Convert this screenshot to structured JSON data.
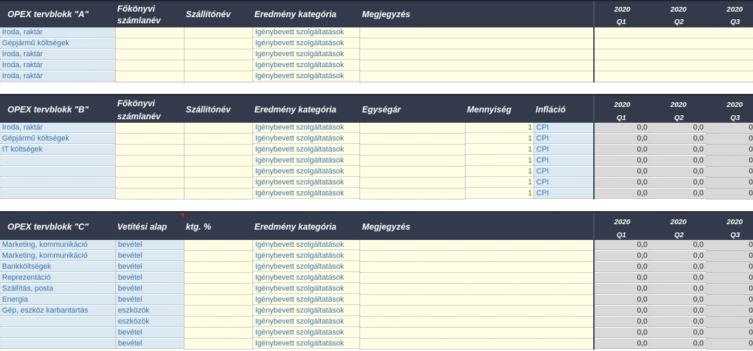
{
  "block_a": {
    "title": "OPEX tervblokk \"A\"",
    "col_fokonyvi": "Főkönyvi",
    "col_fokonyvi2": "számlanév",
    "col_szallito": "Szállítónév",
    "col_eredmeny": "Eredmény kategória",
    "col_megjegyzes": "Megjegyzés",
    "quarters": [
      {
        "year": "2020",
        "q": "Q1"
      },
      {
        "year": "2020",
        "q": "Q2"
      },
      {
        "year": "2020",
        "q": "Q3"
      }
    ],
    "rows": [
      {
        "name": "Iroda, raktár",
        "cat": "Igénybevett szolgáltatások"
      },
      {
        "name": "Gépjármű költségek",
        "cat": "Igénybevett szolgáltatások"
      },
      {
        "name": "Iroda, raktár",
        "cat": "Igénybevett szolgáltatások"
      },
      {
        "name": "Iroda, raktár",
        "cat": "Igénybevett szolgáltatások"
      },
      {
        "name": "Iroda, raktár",
        "cat": "Igénybevett szolgáltatások"
      }
    ]
  },
  "block_b": {
    "title": "OPEX tervblokk \"B\"",
    "col_fokonyvi": "Főkönyvi",
    "col_fokonyvi2": "számlanév",
    "col_szallito": "Szállítónév",
    "col_eredmeny": "Eredmény kategória",
    "col_egysegar": "Egységár",
    "col_mennyiseg": "Mennyiség",
    "col_inflacio": "Infláció",
    "quarters": [
      {
        "year": "2020",
        "q": "Q1"
      },
      {
        "year": "2020",
        "q": "Q2"
      },
      {
        "year": "2020",
        "q": "Q3"
      }
    ],
    "rows": [
      {
        "name": "Iroda, raktár",
        "cat": "Igénybevett szolgáltatások",
        "qty": "1",
        "infl": "CPI",
        "v1": "0,0",
        "v2": "0,0",
        "v3": "0"
      },
      {
        "name": "Gépjármű költségek",
        "cat": "Igénybevett szolgáltatások",
        "qty": "1",
        "infl": "CPI",
        "v1": "0,0",
        "v2": "0,0",
        "v3": "0"
      },
      {
        "name": "IT költségek",
        "cat": "Igénybevett szolgáltatások",
        "qty": "1",
        "infl": "CPI",
        "v1": "0,0",
        "v2": "0,0",
        "v3": "0"
      },
      {
        "name": "",
        "cat": "Igénybevett szolgáltatások",
        "qty": "1",
        "infl": "CPI",
        "v1": "0,0",
        "v2": "0,0",
        "v3": "0"
      },
      {
        "name": "",
        "cat": "Igénybevett szolgáltatások",
        "qty": "1",
        "infl": "CPI",
        "v1": "0,0",
        "v2": "0,0",
        "v3": "0"
      },
      {
        "name": "",
        "cat": "Igénybevett szolgáltatások",
        "qty": "1",
        "infl": "CPI",
        "v1": "0,0",
        "v2": "0,0",
        "v3": "0"
      },
      {
        "name": "",
        "cat": "Igénybevett szolgáltatások",
        "qty": "1",
        "infl": "CPI",
        "v1": "0,0",
        "v2": "0,0",
        "v3": "0"
      }
    ]
  },
  "block_c": {
    "title": "OPEX tervblokk \"C\"",
    "col_vetitesi": "Vetítési alap",
    "col_ktg": "ktg. %",
    "col_eredmeny": "Eredmény kategória",
    "col_megjegyzes": "Megjegyzés",
    "quarters": [
      {
        "year": "2020",
        "q": "Q1"
      },
      {
        "year": "2020",
        "q": "Q2"
      },
      {
        "year": "2020",
        "q": "Q3"
      }
    ],
    "rows": [
      {
        "name": "Marketing, kommunikáció",
        "base": "bevétel",
        "cat": "Igénybevett szolgáltatások",
        "v1": "0,0",
        "v2": "0,0",
        "v3": "0"
      },
      {
        "name": "Marketing, kommunikáció",
        "base": "bevétel",
        "cat": "Igénybevett szolgáltatások",
        "v1": "0,0",
        "v2": "0,0",
        "v3": "0"
      },
      {
        "name": "Bankköltségek",
        "base": "bevétel",
        "cat": "Igénybevett szolgáltatások",
        "v1": "0,0",
        "v2": "0,0",
        "v3": "0"
      },
      {
        "name": "Reprezentáció",
        "base": "bevétel",
        "cat": "Igénybevett szolgáltatások",
        "v1": "0,0",
        "v2": "0,0",
        "v3": "0"
      },
      {
        "name": "Szállítás, posta",
        "base": "bevétel",
        "cat": "Igénybevett szolgáltatások",
        "v1": "0,0",
        "v2": "0,0",
        "v3": "0"
      },
      {
        "name": "Energia",
        "base": "bevétel",
        "cat": "Igénybevett szolgáltatások",
        "v1": "0,0",
        "v2": "0,0",
        "v3": "0"
      },
      {
        "name": "Gép, eszköz karbantartás",
        "base": "eszközök",
        "cat": "Igénybevett szolgáltatások",
        "v1": "0,0",
        "v2": "0,0",
        "v3": "0"
      },
      {
        "name": "",
        "base": "eszközök",
        "cat": "Igénybevett szolgáltatások",
        "v1": "0,0",
        "v2": "0,0",
        "v3": "0"
      },
      {
        "name": "",
        "base": "bevétel",
        "cat": "Igénybevett szolgáltatások",
        "v1": "0,0",
        "v2": "0,0",
        "v3": "0"
      },
      {
        "name": "",
        "base": "bevétel",
        "cat": "Igénybevett szolgáltatások",
        "v1": "0,0",
        "v2": "0,0",
        "v3": "0"
      }
    ]
  },
  "colors": {
    "header_bg": "#323a4b",
    "label_cell": "#dbe9f3",
    "input_cell": "#fffde4",
    "calc_cell": "#d9d9d9",
    "text_blue": "#3b73a8",
    "text_green": "#2f8a2f"
  }
}
